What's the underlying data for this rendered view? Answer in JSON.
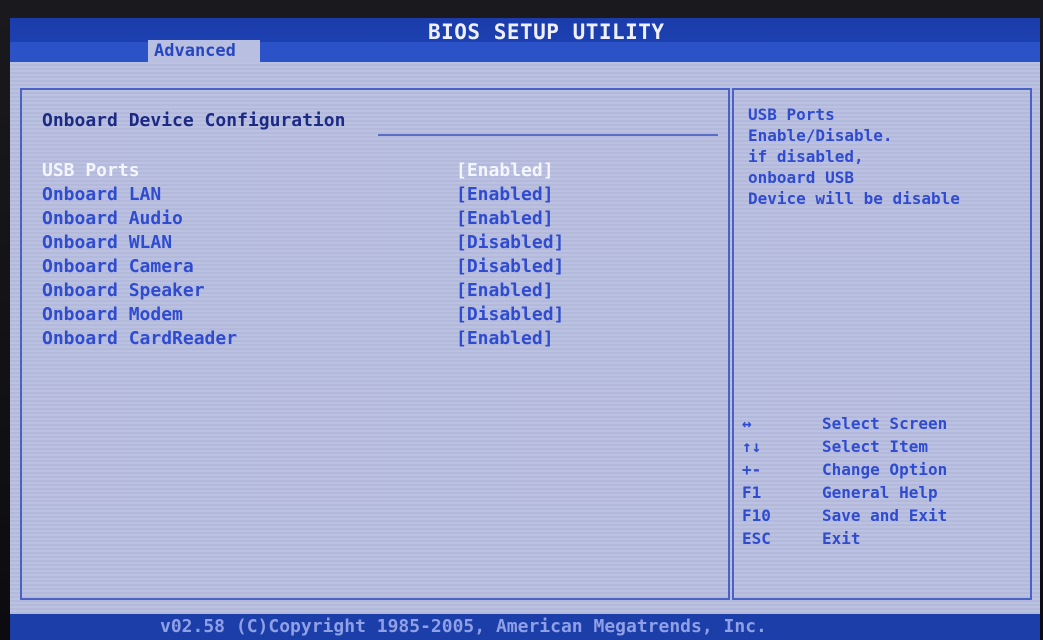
{
  "header": {
    "title": "BIOS SETUP UTILITY",
    "active_tab": "Advanced"
  },
  "main": {
    "section_title": "Onboard Device Configuration",
    "options": [
      {
        "label": "USB Ports",
        "value": "[Enabled]",
        "selected": true
      },
      {
        "label": "Onboard LAN",
        "value": "[Enabled]",
        "selected": false
      },
      {
        "label": "Onboard Audio",
        "value": "[Enabled]",
        "selected": false
      },
      {
        "label": "Onboard WLAN",
        "value": "[Disabled]",
        "selected": false
      },
      {
        "label": "Onboard Camera",
        "value": "[Disabled]",
        "selected": false
      },
      {
        "label": "Onboard Speaker",
        "value": "[Enabled]",
        "selected": false
      },
      {
        "label": "Onboard Modem",
        "value": "[Disabled]",
        "selected": false
      },
      {
        "label": "Onboard CardReader",
        "value": "[Enabled]",
        "selected": false
      }
    ]
  },
  "help": {
    "lines": [
      "USB Ports",
      "Enable/Disable.",
      "if disabled,",
      "onboard USB",
      "Device will be disable"
    ]
  },
  "keys": [
    {
      "key": "↔",
      "desc": "Select Screen"
    },
    {
      "key": "↑↓",
      "desc": "Select Item"
    },
    {
      "key": "+-",
      "desc": "Change Option"
    },
    {
      "key": "F1",
      "desc": "General Help"
    },
    {
      "key": "F10",
      "desc": "Save and Exit"
    },
    {
      "key": "ESC",
      "desc": "Exit"
    }
  ],
  "footer": {
    "text": "v02.58 (C)Copyright 1985-2005, American Megatrends, Inc."
  },
  "colors": {
    "bios_blue": "#1d3fae",
    "panel_gray": "#b7bddf",
    "text_blue": "#2f4bd0",
    "selected_white": "#f4f6ff"
  }
}
